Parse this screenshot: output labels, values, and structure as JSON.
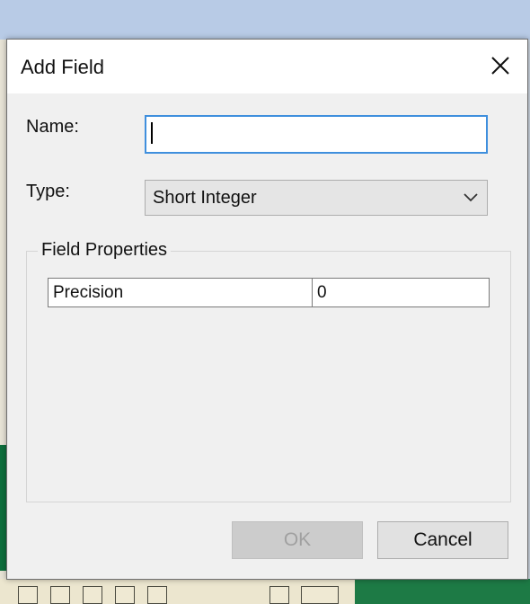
{
  "dialog": {
    "title": "Add Field",
    "close_icon": "close-icon"
  },
  "form": {
    "name_label": "Name:",
    "name_value": "",
    "type_label": "Type:",
    "type_value": "Short Integer"
  },
  "field_properties": {
    "legend": "Field Properties",
    "rows": [
      {
        "property": "Precision",
        "value": "0"
      }
    ]
  },
  "buttons": {
    "ok_label": "OK",
    "ok_enabled": false,
    "cancel_label": "Cancel"
  },
  "colors": {
    "input_focus_border": "#3f8fdd",
    "dialog_background": "#f0f0f0"
  }
}
